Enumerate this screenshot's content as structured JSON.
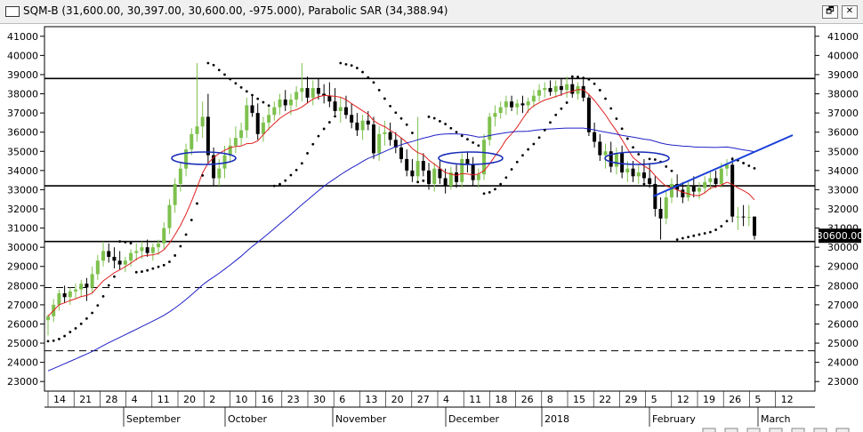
{
  "window": {
    "title": "SQM-B (31,600.00, 30,397.00, 30,600.00, -975.000), Parabolic SAR (34,388.94)",
    "restore_glyph": "🗗",
    "close_glyph": "✕"
  },
  "chart_data": {
    "type": "candlestick",
    "y_ticks": [
      23000,
      24000,
      25000,
      26000,
      27000,
      28000,
      29000,
      30000,
      31000,
      32000,
      33000,
      34000,
      35000,
      36000,
      37000,
      38000,
      39000,
      40000,
      41000
    ],
    "price_label": "30600.00",
    "last_price": 30600,
    "x_day_ticks": [
      "14",
      "21",
      "28",
      "4",
      "11",
      "20",
      "2",
      "10",
      "16",
      "23",
      "30",
      "6",
      "13",
      "20",
      "27",
      "4",
      "11",
      "18",
      "26",
      "8",
      "15",
      "22",
      "29",
      "5",
      "12",
      "19",
      "26",
      "5",
      "12"
    ],
    "x_months": [
      "September",
      "October",
      "November",
      "December",
      "2018",
      "February",
      "March"
    ],
    "horizontal_lines": [
      {
        "value": 38800,
        "style": "solid"
      },
      {
        "value": 33200,
        "style": "solid"
      },
      {
        "value": 30300,
        "style": "solid"
      },
      {
        "value": 27900,
        "style": "dashed"
      },
      {
        "value": 24600,
        "style": "dashed"
      }
    ],
    "colors": {
      "candle_up": "#7ec14e",
      "candle_down": "#000000",
      "ma_short": "#e02020",
      "ma_long": "#2020c8",
      "trendline": "#1a3fd6",
      "ellipse": "#1a2fb8"
    },
    "candles": [
      {
        "o": 26200,
        "h": 26500,
        "l": 25400,
        "c": 26400
      },
      {
        "o": 26400,
        "h": 27300,
        "l": 26100,
        "c": 27000
      },
      {
        "o": 27000,
        "h": 27800,
        "l": 26700,
        "c": 27600
      },
      {
        "o": 27600,
        "h": 28000,
        "l": 27100,
        "c": 27400
      },
      {
        "o": 27400,
        "h": 27900,
        "l": 27000,
        "c": 27700
      },
      {
        "o": 27700,
        "h": 28100,
        "l": 27300,
        "c": 27800
      },
      {
        "o": 27800,
        "h": 28300,
        "l": 27400,
        "c": 28100
      },
      {
        "o": 28100,
        "h": 28400,
        "l": 27200,
        "c": 27900
      },
      {
        "o": 27900,
        "h": 29000,
        "l": 27600,
        "c": 28600
      },
      {
        "o": 28600,
        "h": 29600,
        "l": 28300,
        "c": 29300
      },
      {
        "o": 29300,
        "h": 30300,
        "l": 29000,
        "c": 29800
      },
      {
        "o": 29800,
        "h": 30200,
        "l": 29200,
        "c": 29500
      },
      {
        "o": 29500,
        "h": 30000,
        "l": 28900,
        "c": 29300
      },
      {
        "o": 29300,
        "h": 29800,
        "l": 28800,
        "c": 29100
      },
      {
        "o": 29100,
        "h": 29500,
        "l": 28700,
        "c": 29300
      },
      {
        "o": 29300,
        "h": 29900,
        "l": 29000,
        "c": 29700
      },
      {
        "o": 29700,
        "h": 30200,
        "l": 29300,
        "c": 29800
      },
      {
        "o": 29800,
        "h": 30300,
        "l": 29400,
        "c": 30000
      },
      {
        "o": 30000,
        "h": 30400,
        "l": 29500,
        "c": 29700
      },
      {
        "o": 29700,
        "h": 30200,
        "l": 29300,
        "c": 30000
      },
      {
        "o": 30000,
        "h": 30400,
        "l": 29600,
        "c": 30200
      },
      {
        "o": 30200,
        "h": 31300,
        "l": 29900,
        "c": 31000
      },
      {
        "o": 31000,
        "h": 32500,
        "l": 30700,
        "c": 32200
      },
      {
        "o": 32200,
        "h": 33600,
        "l": 31800,
        "c": 33300
      },
      {
        "o": 33300,
        "h": 34400,
        "l": 32900,
        "c": 34100
      },
      {
        "o": 34100,
        "h": 35400,
        "l": 33700,
        "c": 35100
      },
      {
        "o": 35100,
        "h": 36200,
        "l": 34800,
        "c": 35900
      },
      {
        "o": 35900,
        "h": 39600,
        "l": 35500,
        "c": 36300
      },
      {
        "o": 36300,
        "h": 37600,
        "l": 35700,
        "c": 36800
      },
      {
        "o": 36800,
        "h": 38000,
        "l": 34300,
        "c": 34800
      },
      {
        "o": 34800,
        "h": 35200,
        "l": 33200,
        "c": 33600
      },
      {
        "o": 33600,
        "h": 34600,
        "l": 33200,
        "c": 34100
      },
      {
        "o": 34100,
        "h": 35300,
        "l": 33600,
        "c": 34800
      },
      {
        "o": 34800,
        "h": 35700,
        "l": 34400,
        "c": 35300
      },
      {
        "o": 35300,
        "h": 36300,
        "l": 34900,
        "c": 35700
      },
      {
        "o": 35700,
        "h": 36500,
        "l": 35300,
        "c": 36100
      },
      {
        "o": 36100,
        "h": 37800,
        "l": 35700,
        "c": 37400
      },
      {
        "o": 37400,
        "h": 37900,
        "l": 36800,
        "c": 37000
      },
      {
        "o": 37000,
        "h": 37500,
        "l": 35600,
        "c": 35900
      },
      {
        "o": 35900,
        "h": 36800,
        "l": 35500,
        "c": 36500
      },
      {
        "o": 36500,
        "h": 37300,
        "l": 36100,
        "c": 36900
      },
      {
        "o": 36900,
        "h": 37600,
        "l": 36600,
        "c": 37300
      },
      {
        "o": 37300,
        "h": 38000,
        "l": 36900,
        "c": 37700
      },
      {
        "o": 37700,
        "h": 38200,
        "l": 37100,
        "c": 37400
      },
      {
        "o": 37400,
        "h": 38000,
        "l": 36900,
        "c": 37700
      },
      {
        "o": 37700,
        "h": 38400,
        "l": 37300,
        "c": 38100
      },
      {
        "o": 38100,
        "h": 39600,
        "l": 37600,
        "c": 38300
      },
      {
        "o": 38300,
        "h": 38900,
        "l": 37500,
        "c": 37800
      },
      {
        "o": 37800,
        "h": 38700,
        "l": 37400,
        "c": 38300
      },
      {
        "o": 38300,
        "h": 38800,
        "l": 37700,
        "c": 38000
      },
      {
        "o": 38000,
        "h": 38500,
        "l": 37500,
        "c": 37900
      },
      {
        "o": 37900,
        "h": 38600,
        "l": 37300,
        "c": 37600
      },
      {
        "o": 37600,
        "h": 38300,
        "l": 36900,
        "c": 37100
      },
      {
        "o": 37100,
        "h": 37800,
        "l": 36500,
        "c": 37300
      },
      {
        "o": 37300,
        "h": 37900,
        "l": 36700,
        "c": 36900
      },
      {
        "o": 36900,
        "h": 37500,
        "l": 36200,
        "c": 36500
      },
      {
        "o": 36500,
        "h": 37000,
        "l": 35800,
        "c": 36100
      },
      {
        "o": 36100,
        "h": 36900,
        "l": 35600,
        "c": 36600
      },
      {
        "o": 36600,
        "h": 37100,
        "l": 36100,
        "c": 36400
      },
      {
        "o": 36400,
        "h": 36800,
        "l": 34600,
        "c": 34900
      },
      {
        "o": 34900,
        "h": 36300,
        "l": 34500,
        "c": 35900
      },
      {
        "o": 35900,
        "h": 36600,
        "l": 35300,
        "c": 36000
      },
      {
        "o": 36000,
        "h": 36500,
        "l": 35300,
        "c": 35600
      },
      {
        "o": 35600,
        "h": 36000,
        "l": 34900,
        "c": 35200
      },
      {
        "o": 35200,
        "h": 35700,
        "l": 34400,
        "c": 34600
      },
      {
        "o": 34600,
        "h": 35100,
        "l": 33700,
        "c": 34000
      },
      {
        "o": 34000,
        "h": 34600,
        "l": 33400,
        "c": 33700
      },
      {
        "o": 33700,
        "h": 36800,
        "l": 33400,
        "c": 34500
      },
      {
        "o": 34500,
        "h": 34900,
        "l": 33700,
        "c": 34000
      },
      {
        "o": 34000,
        "h": 34400,
        "l": 33000,
        "c": 33300
      },
      {
        "o": 33300,
        "h": 34400,
        "l": 32900,
        "c": 34100
      },
      {
        "o": 34100,
        "h": 34500,
        "l": 33300,
        "c": 33600
      },
      {
        "o": 33600,
        "h": 34100,
        "l": 32800,
        "c": 33200
      },
      {
        "o": 33200,
        "h": 34200,
        "l": 33000,
        "c": 33900
      },
      {
        "o": 33900,
        "h": 34300,
        "l": 33100,
        "c": 33400
      },
      {
        "o": 33400,
        "h": 34900,
        "l": 33100,
        "c": 34600
      },
      {
        "o": 34600,
        "h": 35000,
        "l": 33900,
        "c": 34300
      },
      {
        "o": 34300,
        "h": 34700,
        "l": 33200,
        "c": 33500
      },
      {
        "o": 33500,
        "h": 34100,
        "l": 33100,
        "c": 33800
      },
      {
        "o": 33800,
        "h": 35900,
        "l": 33500,
        "c": 35600
      },
      {
        "o": 35600,
        "h": 37000,
        "l": 35300,
        "c": 36800
      },
      {
        "o": 36800,
        "h": 37400,
        "l": 36300,
        "c": 37000
      },
      {
        "o": 37000,
        "h": 37600,
        "l": 36700,
        "c": 37300
      },
      {
        "o": 37300,
        "h": 37900,
        "l": 36900,
        "c": 37600
      },
      {
        "o": 37600,
        "h": 37900,
        "l": 37100,
        "c": 37300
      },
      {
        "o": 37300,
        "h": 37700,
        "l": 36900,
        "c": 37500
      },
      {
        "o": 37500,
        "h": 37900,
        "l": 37000,
        "c": 37400
      },
      {
        "o": 37400,
        "h": 37800,
        "l": 37000,
        "c": 37600
      },
      {
        "o": 37600,
        "h": 38200,
        "l": 37300,
        "c": 37900
      },
      {
        "o": 37900,
        "h": 38500,
        "l": 37600,
        "c": 38200
      },
      {
        "o": 38200,
        "h": 38600,
        "l": 37800,
        "c": 38300
      },
      {
        "o": 38300,
        "h": 38700,
        "l": 37900,
        "c": 38100
      },
      {
        "o": 38100,
        "h": 38700,
        "l": 37800,
        "c": 38400
      },
      {
        "o": 38400,
        "h": 38800,
        "l": 37900,
        "c": 38200
      },
      {
        "o": 38200,
        "h": 38900,
        "l": 37800,
        "c": 38500
      },
      {
        "o": 38500,
        "h": 38800,
        "l": 37800,
        "c": 38000
      },
      {
        "o": 38000,
        "h": 38600,
        "l": 37700,
        "c": 38400
      },
      {
        "o": 38400,
        "h": 38800,
        "l": 37600,
        "c": 37800
      },
      {
        "o": 37800,
        "h": 38000,
        "l": 35800,
        "c": 36000
      },
      {
        "o": 36000,
        "h": 36500,
        "l": 35200,
        "c": 35500
      },
      {
        "o": 35500,
        "h": 35900,
        "l": 34500,
        "c": 34800
      },
      {
        "o": 34800,
        "h": 35400,
        "l": 34100,
        "c": 35000
      },
      {
        "o": 35000,
        "h": 35500,
        "l": 33900,
        "c": 34200
      },
      {
        "o": 34200,
        "h": 35200,
        "l": 33800,
        "c": 34900
      },
      {
        "o": 34900,
        "h": 35300,
        "l": 33600,
        "c": 33900
      },
      {
        "o": 33900,
        "h": 34500,
        "l": 33400,
        "c": 34100
      },
      {
        "o": 34100,
        "h": 34500,
        "l": 33400,
        "c": 33700
      },
      {
        "o": 33700,
        "h": 34300,
        "l": 33300,
        "c": 33900
      },
      {
        "o": 33900,
        "h": 34600,
        "l": 33400,
        "c": 33600
      },
      {
        "o": 33600,
        "h": 34400,
        "l": 33100,
        "c": 33300
      },
      {
        "o": 33300,
        "h": 33700,
        "l": 31600,
        "c": 32000
      },
      {
        "o": 32000,
        "h": 32600,
        "l": 30400,
        "c": 31500
      },
      {
        "o": 31500,
        "h": 32900,
        "l": 31200,
        "c": 32600
      },
      {
        "o": 32600,
        "h": 33600,
        "l": 32300,
        "c": 33300
      },
      {
        "o": 33300,
        "h": 33800,
        "l": 32600,
        "c": 33000
      },
      {
        "o": 33000,
        "h": 33400,
        "l": 32300,
        "c": 32600
      },
      {
        "o": 32600,
        "h": 33500,
        "l": 32400,
        "c": 33200
      },
      {
        "o": 33200,
        "h": 33700,
        "l": 32600,
        "c": 32900
      },
      {
        "o": 32900,
        "h": 33400,
        "l": 32500,
        "c": 33100
      },
      {
        "o": 33100,
        "h": 33700,
        "l": 32800,
        "c": 33400
      },
      {
        "o": 33400,
        "h": 33900,
        "l": 33000,
        "c": 33600
      },
      {
        "o": 33600,
        "h": 34000,
        "l": 33100,
        "c": 33300
      },
      {
        "o": 33300,
        "h": 34400,
        "l": 33100,
        "c": 34100
      },
      {
        "o": 34100,
        "h": 34600,
        "l": 33700,
        "c": 34300
      },
      {
        "o": 34300,
        "h": 34700,
        "l": 31300,
        "c": 31600
      },
      {
        "o": 31600,
        "h": 32100,
        "l": 30900,
        "c": 31600
      },
      {
        "o": 31600,
        "h": 32200,
        "l": 31100,
        "c": 31575
      },
      {
        "o": 31575,
        "h": 32200,
        "l": 31100,
        "c": 31575
      },
      {
        "o": 31600,
        "h": 31600,
        "l": 30397,
        "c": 30600
      }
    ]
  },
  "footer": {
    "icons": [
      "hand-icon",
      "zoom-icon",
      "ellipsis-icon",
      "scroll-left-icon",
      "scroll-right-icon",
      "next-icon",
      "end-icon"
    ]
  }
}
